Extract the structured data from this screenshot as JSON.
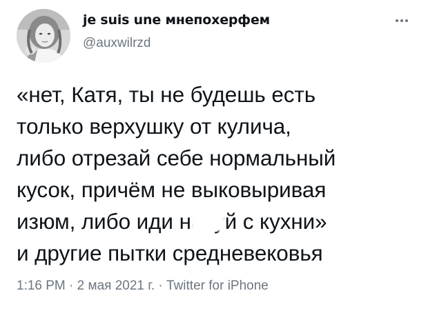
{
  "tweet": {
    "display_name": "je suis une мнепохерфем",
    "handle": "@auxwilrzd",
    "more_icon": "more-horizontal-icon",
    "text_lines": [
      "«нет, Катя, ты не будешь есть",
      "только верхушку от кулича,",
      "либо отрезай себе нормальный",
      "кусок, причём не выковыривая",
      "изюм, либо иди нахуй с кухни»",
      "и другие пытки средневековья"
    ],
    "time": "1:16 PM",
    "separator": "·",
    "date": "2 мая 2021 г.",
    "source": "Twitter for iPhone"
  },
  "colors": {
    "text": "#0f1419",
    "secondary": "#6b7680",
    "background": "#ffffff"
  }
}
